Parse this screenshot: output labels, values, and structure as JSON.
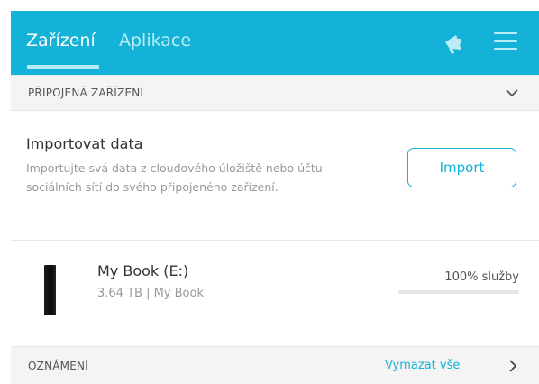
{
  "header": {
    "tabs": [
      {
        "label": "Zařízení",
        "active": true
      },
      {
        "label": "Aplikace",
        "active": false
      }
    ],
    "icons": [
      "megaphone-icon",
      "menu-icon"
    ],
    "colors": {
      "brand": "#14b2d8",
      "tab_inactive": "#b9ecf7"
    }
  },
  "connected_section": {
    "title": "PŘIPOJENÁ ZAŘÍZENÍ"
  },
  "import": {
    "title": "Importovat data",
    "description": "Importujte svá data z cloudového úložiště nebo účtu sociálních sítí do svého připojeného zařízení.",
    "button_label": "Import"
  },
  "device": {
    "name": "My Book (E:)",
    "details": "3.64 TB | My Book",
    "usage_label": "100% služby"
  },
  "notifications": {
    "title": "OZNÁMENÍ",
    "clear_label": "Vymazat vše"
  }
}
